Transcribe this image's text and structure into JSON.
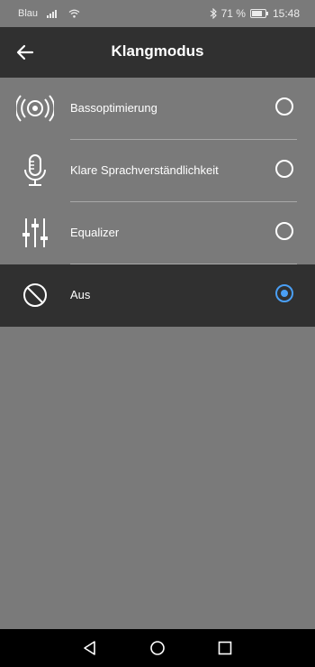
{
  "status_bar": {
    "carrier": "Blau",
    "battery_percent": "71 %",
    "time": "15:48",
    "icons": [
      "signal-icon",
      "wifi-icon",
      "bluetooth-icon",
      "battery-icon"
    ]
  },
  "app_bar": {
    "title": "Klangmodus",
    "back_icon": "arrow-left-icon"
  },
  "options": [
    {
      "label": "Bassoptimierung",
      "icon": "speaker-waves-icon",
      "selected": false
    },
    {
      "label": "Klare Sprachverständlichkeit",
      "icon": "microphone-icon",
      "selected": false
    },
    {
      "label": "Equalizer",
      "icon": "sliders-icon",
      "selected": false
    },
    {
      "label": "Aus",
      "icon": "off-circle-icon",
      "selected": true
    }
  ],
  "nav_bar": {
    "icons": [
      "back-triangle-icon",
      "home-circle-icon",
      "recents-square-icon"
    ]
  },
  "colors": {
    "background": "#7a7a7a",
    "app_bar": "#303030",
    "accent": "#4a9ff5",
    "nav_bar": "#000000"
  }
}
